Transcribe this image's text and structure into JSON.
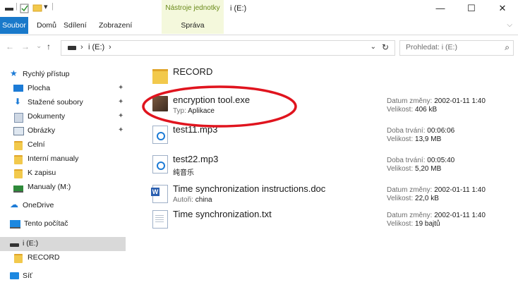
{
  "titlebar": {
    "context_tab_label": "Nástroje jednotky",
    "window_title": "i (E:)",
    "minimize_glyph": "—",
    "maximize_glyph": "☐",
    "close_glyph": "✕",
    "qa_dropdown_glyph": "▾"
  },
  "ribbon": {
    "tabs": [
      "Soubor",
      "Domů",
      "Sdílení",
      "Zobrazení",
      "Správa"
    ],
    "collapse_glyph": "⌵"
  },
  "address": {
    "back_glyph": "←",
    "forward_glyph": "→",
    "recent_glyph": "⌄",
    "up_glyph": "↑",
    "sep_glyph": "›",
    "location": "i (E:)",
    "dropdown_glyph": "⌄",
    "refresh_glyph": "↻"
  },
  "search": {
    "placeholder": "Prohledat: i (E:)",
    "icon_glyph": "⌕"
  },
  "sidebar": {
    "pin_glyph": "✦",
    "items": [
      {
        "label": "Rychlý přístup",
        "icon": "star-icon"
      },
      {
        "label": "Plocha",
        "icon": "desktop-icon",
        "pinned": true
      },
      {
        "label": "Stažené soubory",
        "icon": "download-icon",
        "pinned": true
      },
      {
        "label": "Dokumenty",
        "icon": "documents-icon",
        "pinned": true
      },
      {
        "label": "Obrázky",
        "icon": "pictures-icon",
        "pinned": true
      },
      {
        "label": "Celní",
        "icon": "folder-icon"
      },
      {
        "label": "Interní manualy",
        "icon": "folder-icon"
      },
      {
        "label": "K zapisu",
        "icon": "folder-icon"
      },
      {
        "label": "Manualy (M:)",
        "icon": "network-drive-icon"
      },
      {
        "label": "OneDrive",
        "icon": "onedrive-icon"
      },
      {
        "label": "Tento počítač",
        "icon": "this-pc-icon"
      },
      {
        "label": "i (E:)",
        "icon": "drive-icon",
        "selected": true
      },
      {
        "label": "RECORD",
        "icon": "folder-icon"
      },
      {
        "label": "Síť",
        "icon": "network-icon"
      }
    ]
  },
  "files": [
    {
      "name": "RECORD",
      "icon": "folder-icon"
    },
    {
      "name": "encryption tool.exe",
      "icon": "application-icon",
      "sub_key": "Typ:",
      "sub_val": "Aplikace",
      "meta1_key": "Datum změny:",
      "meta1_val": "2002-01-11 1:40",
      "meta2_key": "Velikost:",
      "meta2_val": "406 kB"
    },
    {
      "name": "test11.mp3",
      "icon": "audio-file-icon",
      "meta1_key": "Doba trvání:",
      "meta1_val": "00:06:06",
      "meta2_key": "Velikost:",
      "meta2_val": "13,9 MB"
    },
    {
      "name": "test22.mp3",
      "icon": "audio-file-icon",
      "sub_val": "纯音乐",
      "meta1_key": "Doba trvání:",
      "meta1_val": "00:05:40",
      "meta2_key": "Velikost:",
      "meta2_val": "5,20 MB"
    },
    {
      "name": "Time synchronization instructions.doc",
      "icon": "word-document-icon",
      "sub_key": "Autoři:",
      "sub_val": "china",
      "meta1_key": "Datum změny:",
      "meta1_val": "2002-01-11 1:40",
      "meta2_key": "Velikost:",
      "meta2_val": "22,0 kB"
    },
    {
      "name": "Time synchronization.txt",
      "icon": "text-file-icon",
      "meta1_key": "Datum změny:",
      "meta1_val": "2002-01-11 1:40",
      "meta2_key": "Velikost:",
      "meta2_val": "19 bajtů"
    }
  ],
  "colors": {
    "accent": "#1979ca",
    "selection": "#d9d9d9",
    "annotation": "#e0141e",
    "context_tab_bg": "#f4f8dc"
  }
}
